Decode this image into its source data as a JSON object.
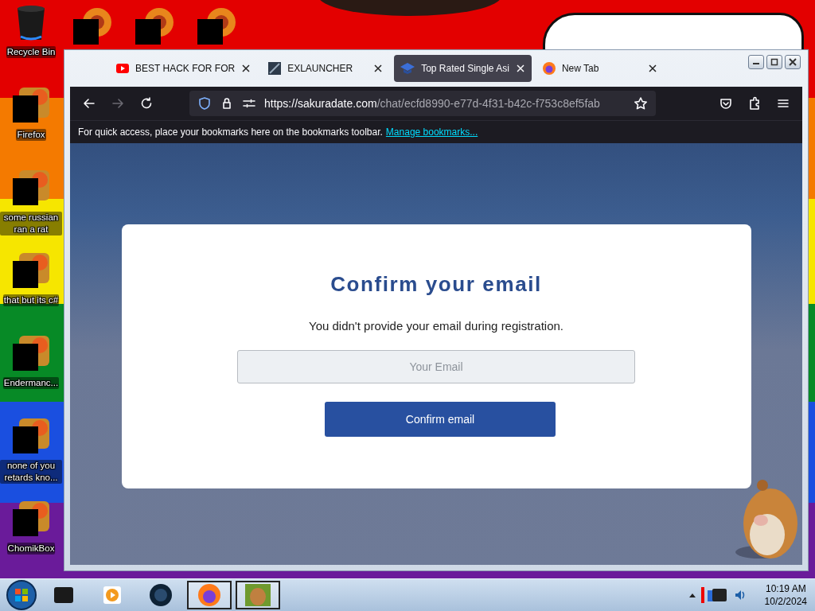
{
  "desktop": {
    "icons": [
      {
        "label": "Recycle Bin",
        "kind": "bin"
      },
      {
        "label": "Firefox",
        "kind": "redacted"
      },
      {
        "label": "some russian ran a rat",
        "kind": "redacted"
      },
      {
        "label": "that but its c#",
        "kind": "redacted"
      },
      {
        "label": "Endermanc...",
        "kind": "redacted"
      },
      {
        "label": "none of you retards kno...",
        "kind": "redacted"
      },
      {
        "label": "ChomikBox",
        "kind": "redacted"
      }
    ]
  },
  "browser": {
    "tabs": [
      {
        "title": "BEST HACK FOR FOR",
        "selected": false,
        "kind": "video"
      },
      {
        "title": "EXLAUNCHER",
        "selected": false,
        "kind": "image"
      },
      {
        "title": "Top Rated Single Asi",
        "selected": true,
        "kind": "cap"
      },
      {
        "title": "New Tab",
        "selected": false,
        "kind": "fox"
      }
    ],
    "navigation": {
      "back_disabled": false,
      "forward_disabled": true
    },
    "url": {
      "domain": "https://sakuradate.com",
      "path": "/chat/ecfd8990-e77d-4f31-b42c-f753c8ef5fab"
    },
    "bookmarks_bar": {
      "text": "For quick access, place your bookmarks here on the bookmarks toolbar.",
      "link": "Manage bookmarks..."
    },
    "dialog": {
      "title": "Confirm your email",
      "message": "You didn't provide your email during registration.",
      "email_field": {
        "placeholder": "Your Email"
      },
      "button": "Confirm email"
    }
  },
  "taskbar": {
    "time": "10:19 AM",
    "date": "10/2/2024"
  }
}
